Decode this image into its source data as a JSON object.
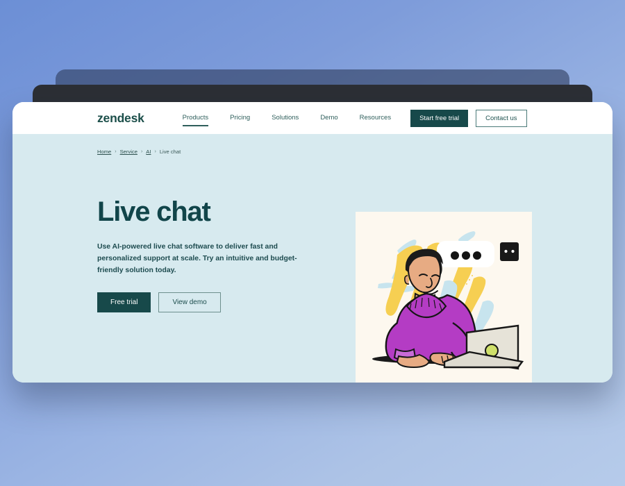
{
  "window": {
    "background_gradient_from": "#6c8fd6",
    "background_gradient_to": "#b6cbea",
    "layer_back_color": "#2e3e5f",
    "layer_mid_color": "#2c2f35"
  },
  "nav": {
    "logo": "zendesk",
    "links": [
      {
        "label": "Products",
        "active": true
      },
      {
        "label": "Pricing",
        "active": false
      },
      {
        "label": "Solutions",
        "active": false
      },
      {
        "label": "Demo",
        "active": false
      },
      {
        "label": "Resources",
        "active": false
      }
    ],
    "trial_button": "Start free trial",
    "contact_button": "Contact us",
    "accent_color": "#17494a"
  },
  "breadcrumb": {
    "items": [
      "Home",
      "Service",
      "AI"
    ],
    "current": "Live chat",
    "separator": "›"
  },
  "hero": {
    "title": "Live chat",
    "body": "Use AI-powered live chat software to deliver fast and personalized support at scale. Try an intuitive and budget-friendly solution today.",
    "primary_button": "Free trial",
    "secondary_button": "View demo",
    "background_color": "#d7eaef",
    "title_color": "#11454a"
  },
  "illustration": {
    "alt": "Person in purple sweater typing on a laptop with a chat bubble and bot icon",
    "panel_background": "#fdf8ef",
    "sweater_color": "#b43cc4",
    "brush_yellow": "#f6cf52",
    "brush_blue": "#c7e4ee",
    "bubble_color": "#ffffff",
    "bot_color": "#1b1b1b",
    "laptop_sticker_color": "#cfe06a"
  }
}
